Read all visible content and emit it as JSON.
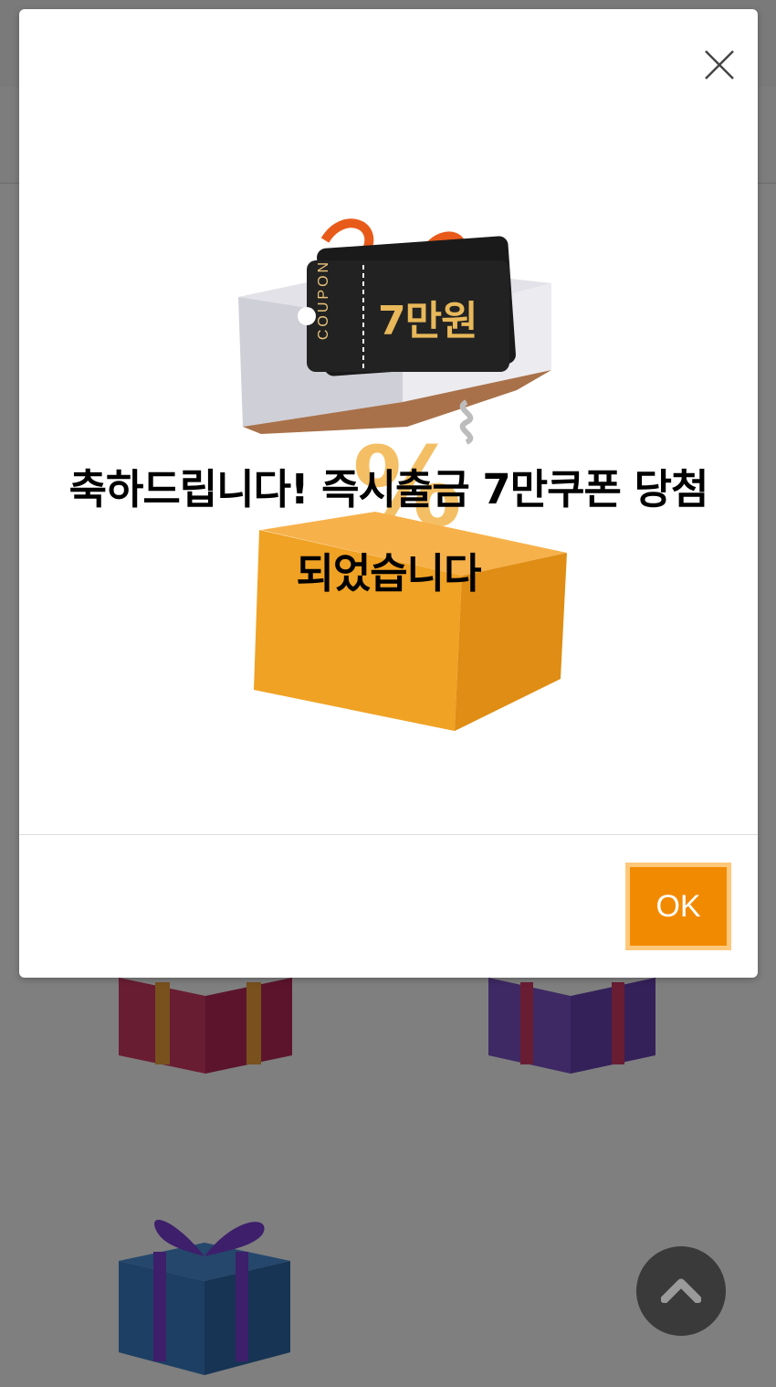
{
  "dialog": {
    "message_line1": "축하드립니다! 즉시출금 7만쿠폰 당첨",
    "message_line2": "되었습니다",
    "ok_label": "OK",
    "close_icon": "close-icon"
  },
  "coupon": {
    "side_label": "COUPON",
    "amount": "7만원"
  },
  "page": {
    "scroll_top_icon": "chevron-up-icon",
    "gift_icons": [
      "gift-box-red-icon",
      "gift-box-purple-icon",
      "gift-box-blue-icon"
    ]
  },
  "colors": {
    "accent": "#f28a00",
    "accent_border": "#ffc87a",
    "overlay": "rgba(0,0,0,0.5)"
  }
}
